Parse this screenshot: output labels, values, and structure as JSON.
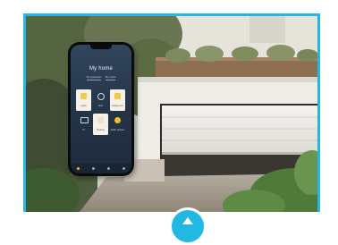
{
  "app": {
    "title": "My home",
    "tabs": [
      "My equipment",
      "My rooms"
    ],
    "tiles": [
      {
        "label": "Lights"
      },
      {
        "label": "Door"
      },
      {
        "label": "Garage door"
      },
      {
        "label": "TV"
      },
      {
        "label": "Shutters"
      },
      {
        "label": "Roller shutters"
      }
    ]
  },
  "colors": {
    "frame": "#21b8e4",
    "accent": "#f3bd2b",
    "phone_screen": "#243447"
  },
  "icons": [
    "home-tab-icon",
    "scene-tab-icon",
    "clock-tab-icon",
    "more-tab-icon",
    "chevron-up-icon"
  ]
}
